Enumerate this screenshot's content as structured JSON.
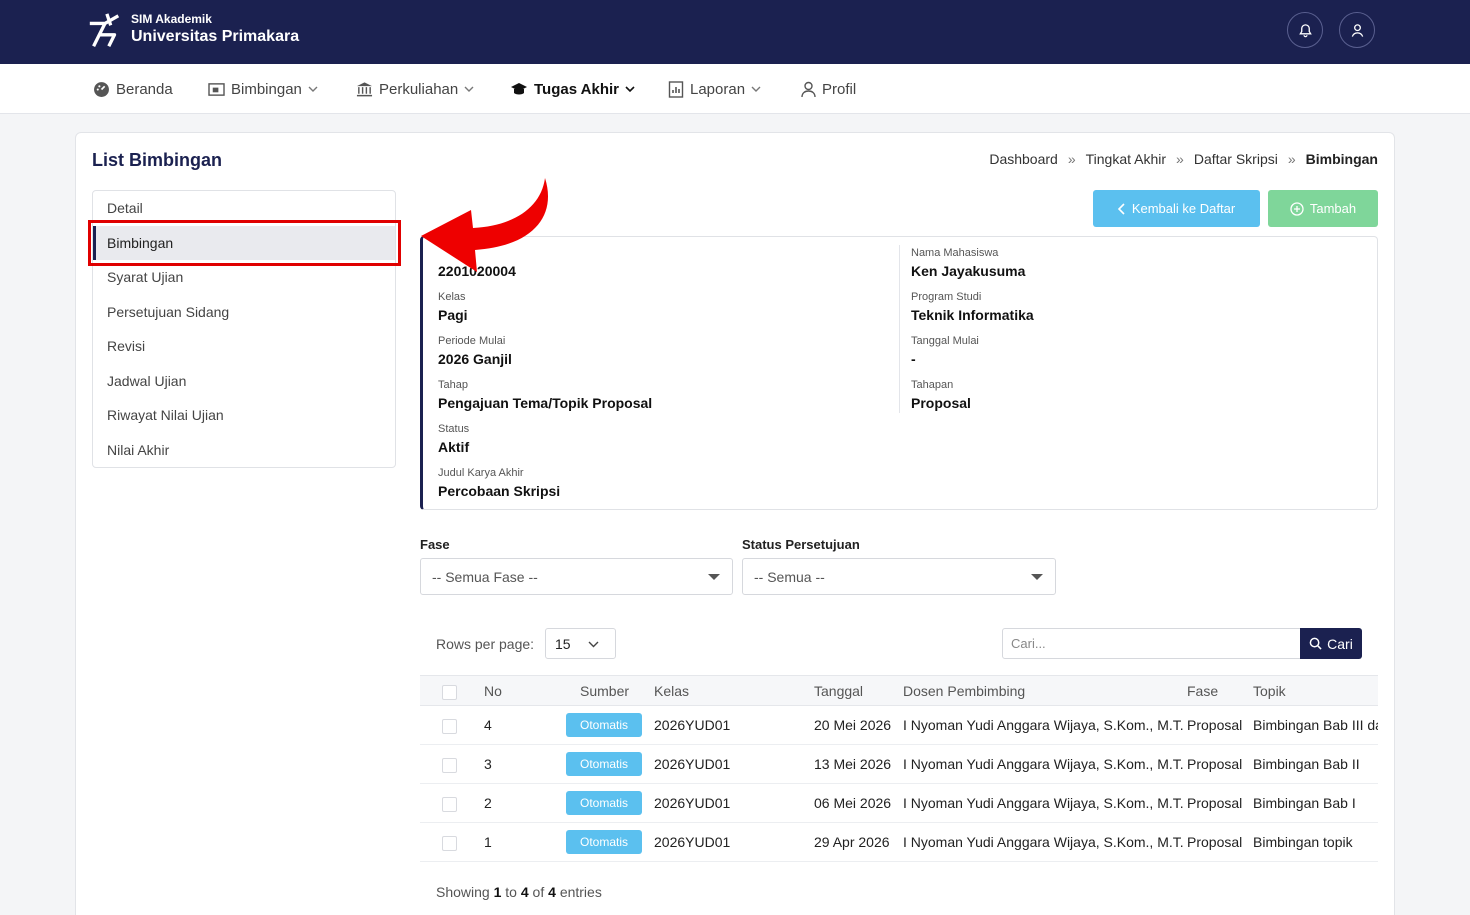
{
  "header": {
    "brand_small": "SIM Akademik",
    "brand_big": "Universitas Primakara",
    "bell_icon": "bell-icon",
    "user_icon": "user-icon",
    "bg_color": "#1b2150"
  },
  "nav": [
    {
      "label": "Beranda",
      "icon": "dashboard-icon",
      "dropdown": false
    },
    {
      "label": "Bimbingan",
      "icon": "presentation-icon",
      "dropdown": true
    },
    {
      "label": "Perkuliahan",
      "icon": "building-icon",
      "dropdown": true
    },
    {
      "label": "Tugas Akhir",
      "icon": "graduation-cap-icon",
      "dropdown": true,
      "active": true
    },
    {
      "label": "Laporan",
      "icon": "report-icon",
      "dropdown": true
    },
    {
      "label": "Profil",
      "icon": "person-icon",
      "dropdown": false
    }
  ],
  "page": {
    "title": "List Bimbingan",
    "breadcrumb": [
      "Dashboard",
      "Tingkat Akhir",
      "Daftar Skripsi",
      "Bimbingan"
    ],
    "breadcrumb_sep": "»"
  },
  "side_menu": [
    {
      "label": "Detail"
    },
    {
      "label": "Bimbingan",
      "active": true
    },
    {
      "label": "Syarat Ujian"
    },
    {
      "label": "Persetujuan Sidang"
    },
    {
      "label": "Revisi"
    },
    {
      "label": "Jadwal Ujian"
    },
    {
      "label": "Riwayat Nilai Ujian"
    },
    {
      "label": "Nilai Akhir"
    }
  ],
  "actions": {
    "back_label": "Kembali ke Daftar",
    "add_label": "Tambah",
    "back_color": "#5bc0ef",
    "add_color": "#7fd69a"
  },
  "info": {
    "left": [
      {
        "label": "",
        "value": "2201020004"
      },
      {
        "label": "Kelas",
        "value": "Pagi"
      },
      {
        "label": "Periode Mulai",
        "value": "2026 Ganjil"
      },
      {
        "label": "Tahap",
        "value": "Pengajuan Tema/Topik Proposal"
      },
      {
        "label": "Status",
        "value": "Aktif"
      },
      {
        "label": "Judul Karya Akhir",
        "value": "Percobaan Skripsi"
      }
    ],
    "right": [
      {
        "label": "Nama Mahasiswa",
        "value": "Ken Jayakusuma"
      },
      {
        "label": "Program Studi",
        "value": "Teknik Informatika"
      },
      {
        "label": "Tanggal Mulai",
        "value": "-"
      },
      {
        "label": "Tahapan",
        "value": "Proposal"
      }
    ]
  },
  "filters": {
    "fase_label": "Fase",
    "fase_value": "-- Semua Fase --",
    "status_label": "Status Persetujuan",
    "status_value": "-- Semua --"
  },
  "table_controls": {
    "rows_label": "Rows per page:",
    "rows_value": "15",
    "search_placeholder": "Cari...",
    "search_button": "Cari"
  },
  "table": {
    "columns": [
      "No",
      "Sumber",
      "Kelas",
      "Tanggal",
      "Dosen Pembimbing",
      "Fase",
      "Topik"
    ],
    "rows": [
      {
        "no": "4",
        "sumber": "Otomatis",
        "kelas": "2026YUD01",
        "tanggal": "20 Mei 2026",
        "dosen": "I Nyoman Yudi Anggara Wijaya, S.Kom., M.T.",
        "fase": "Proposal",
        "topik": "Bimbingan Bab III dan"
      },
      {
        "no": "3",
        "sumber": "Otomatis",
        "kelas": "2026YUD01",
        "tanggal": "13 Mei 2026",
        "dosen": "I Nyoman Yudi Anggara Wijaya, S.Kom., M.T.",
        "fase": "Proposal",
        "topik": "Bimbingan Bab II"
      },
      {
        "no": "2",
        "sumber": "Otomatis",
        "kelas": "2026YUD01",
        "tanggal": "06 Mei 2026",
        "dosen": "I Nyoman Yudi Anggara Wijaya, S.Kom., M.T.",
        "fase": "Proposal",
        "topik": "Bimbingan Bab I"
      },
      {
        "no": "1",
        "sumber": "Otomatis",
        "kelas": "2026YUD01",
        "tanggal": "29 Apr 2026",
        "dosen": "I Nyoman Yudi Anggara Wijaya, S.Kom., M.T.",
        "fase": "Proposal",
        "topik": "Bimbingan topik"
      }
    ]
  },
  "footer": {
    "showing_prefix": "Showing",
    "from": "1",
    "to_word": "to",
    "to": "4",
    "of_word": "of",
    "total": "4",
    "entries_word": "entries"
  },
  "annotation": {
    "highlight_color": "#e00000",
    "arrow_icon": "red-arrow-icon"
  }
}
